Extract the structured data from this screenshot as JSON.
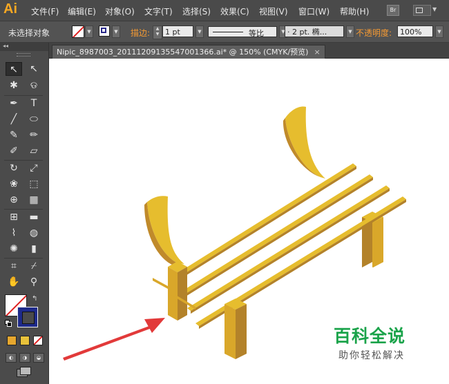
{
  "app": {
    "logo": "Ai",
    "menu": [
      "文件(F)",
      "编辑(E)",
      "对象(O)",
      "文字(T)",
      "选择(S)",
      "效果(C)",
      "视图(V)",
      "窗口(W)",
      "帮助(H)"
    ],
    "bridge_label": "Br"
  },
  "control_bar": {
    "selection_status": "未选择对象",
    "stroke_label": "描边:",
    "stroke_weight": "1 pt",
    "line_style_label": "等比",
    "brush_label": "· 2 pt. 椭...",
    "opacity_label": "不透明度:",
    "opacity_value": "100%"
  },
  "document": {
    "tab_title": "Nipic_8987003_20111209135547001366.ai* @ 150% (CMYK/预览)",
    "close_glyph": "×"
  },
  "tools": [
    {
      "name": "selection-tool",
      "glyph": "↖"
    },
    {
      "name": "direct-selection-tool",
      "glyph": "↖"
    },
    {
      "name": "magic-wand-tool",
      "glyph": "✱"
    },
    {
      "name": "lasso-tool",
      "glyph": "ଡ"
    },
    {
      "name": "pen-tool",
      "glyph": "✒"
    },
    {
      "name": "type-tool",
      "glyph": "T"
    },
    {
      "name": "line-segment-tool",
      "glyph": "╱"
    },
    {
      "name": "ellipse-tool",
      "glyph": "⬭"
    },
    {
      "name": "paintbrush-tool",
      "glyph": "✎"
    },
    {
      "name": "pencil-tool",
      "glyph": "✏"
    },
    {
      "name": "blob-brush-tool",
      "glyph": "✐"
    },
    {
      "name": "eraser-tool",
      "glyph": "▱"
    },
    {
      "name": "rotate-tool",
      "glyph": "↻"
    },
    {
      "name": "scale-tool",
      "glyph": "⤢"
    },
    {
      "name": "warp-tool",
      "glyph": "❀"
    },
    {
      "name": "free-transform-tool",
      "glyph": "⬚"
    },
    {
      "name": "shape-builder-tool",
      "glyph": "⊕"
    },
    {
      "name": "perspective-grid-tool",
      "glyph": "▦"
    },
    {
      "name": "mesh-tool",
      "glyph": "⊞"
    },
    {
      "name": "gradient-tool",
      "glyph": "▬"
    },
    {
      "name": "eyedropper-tool",
      "glyph": "⌇"
    },
    {
      "name": "blend-tool",
      "glyph": "◍"
    },
    {
      "name": "symbol-sprayer-tool",
      "glyph": "✺"
    },
    {
      "name": "column-graph-tool",
      "glyph": "▮"
    },
    {
      "name": "artboard-tool",
      "glyph": "⌗"
    },
    {
      "name": "slice-tool",
      "glyph": "⌿"
    },
    {
      "name": "hand-tool",
      "glyph": "✋"
    },
    {
      "name": "zoom-tool",
      "glyph": "⚲"
    }
  ],
  "colors": {
    "accent_orange": "#f59a33",
    "bench_light": "#e6bd2e",
    "bench_mid": "#d9a72a",
    "bench_dark": "#b3822a",
    "arrow_red": "#e23a3a",
    "watermark_green": "#1aa34a"
  },
  "watermark": {
    "title": "百科全说",
    "subtitle": "助你轻松解决"
  }
}
